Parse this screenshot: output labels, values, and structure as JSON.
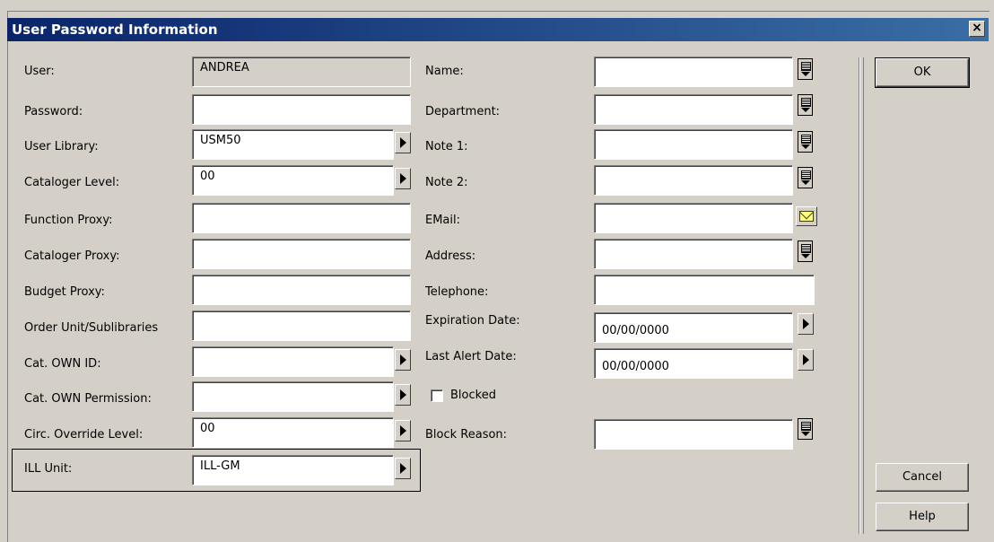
{
  "window": {
    "title": "User Password Information",
    "close_label": "×"
  },
  "left_labels": [
    "User:",
    "Password:",
    "User Library:",
    "Cataloger Level:",
    "Function Proxy:",
    "Cataloger Proxy:",
    "Budget Proxy:",
    "Order Unit/Sublibraries",
    "Cat. OWN ID:",
    "Cat. OWN Permission:",
    "Circ. Override Level:",
    "ILL Unit:"
  ],
  "left_values": [
    "ANDREA",
    "",
    "USM50",
    "00",
    "",
    "",
    "",
    "",
    "",
    "",
    "00",
    "ILL-GM"
  ],
  "right_labels": [
    "Name:",
    "Department:",
    "Note 1:",
    "Note 2:",
    "EMail:",
    "Address:",
    "Telephone:",
    "Expiration Date:",
    "Last Alert Date:",
    "Blocked",
    "Block Reason:"
  ],
  "right_values": {
    "expiration_date": "00/00/0000",
    "last_alert_date": "00/00/0000"
  },
  "buttons": {
    "ok": "OK",
    "cancel": "Cancel",
    "help": "Help"
  },
  "icons": {
    "list": "list-picker-icon",
    "arrow": "arrow-right-icon",
    "email": "envelope-icon",
    "close": "close-icon"
  }
}
